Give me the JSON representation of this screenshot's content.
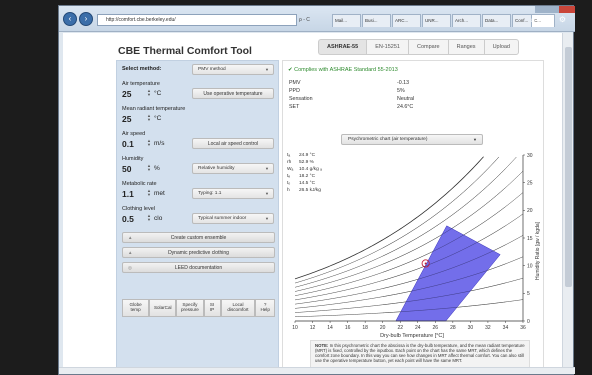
{
  "browser": {
    "url": "http://comfort.cbe.berkeley.edu/",
    "address_tools": "ρ - C",
    "tabs": [
      "Mail...",
      "Busi...",
      "ARC...",
      "UNR...",
      "Arch...",
      "Data...",
      "Conf...",
      "C..."
    ],
    "active_tab": "C...",
    "toolbar_icons": "⌂ ★ ⚙"
  },
  "app": {
    "title": "CBE Thermal Comfort Tool",
    "tabs": [
      "ASHRAE-55",
      "EN-15251",
      "Compare",
      "Ranges",
      "Upload"
    ],
    "active_tab": "ASHRAE-55"
  },
  "inputs": {
    "method_label": "Select method:",
    "method_value": "PMV method",
    "air_temp": {
      "label": "Air temperature",
      "value": "25",
      "unit": "°C",
      "button": "Use operative temperature"
    },
    "mrt": {
      "label": "Mean radiant temperature",
      "value": "25",
      "unit": "°C"
    },
    "air_speed": {
      "label": "Air speed",
      "value": "0.1",
      "unit": "m/s",
      "button": "Local air speed control"
    },
    "humidity": {
      "label": "Humidity",
      "value": "50",
      "unit": "%",
      "select": "Relative humidity"
    },
    "metabolic": {
      "label": "Metabolic rate",
      "value": "1.1",
      "unit": "met",
      "select": "Typing: 1.1"
    },
    "clothing": {
      "label": "Clothing level",
      "value": "0.5",
      "unit": "clo",
      "select": "Typical summer indoor"
    }
  },
  "actions": {
    "custom_ensemble": "Create custom ensemble",
    "dynamic_clothing": "Dynamic predictive clothing",
    "leed": "LEED documentation"
  },
  "tools": [
    {
      "line1": "Globe",
      "line2": "temp"
    },
    {
      "line1": "SolarCal",
      "line2": ""
    },
    {
      "line1": "Specify",
      "line2": "pressure"
    },
    {
      "line1": "SI",
      "line2": "IP"
    },
    {
      "line1": "Local",
      "line2": "discomfort"
    },
    {
      "line1": "?",
      "line2": "Help"
    }
  ],
  "results": {
    "compliance": "✔  Complies with ASHRAE Standard 55-2013",
    "rows": [
      {
        "k": "PMV",
        "v": "-0.13"
      },
      {
        "k": "PPD",
        "v": "5%"
      },
      {
        "k": "Sensation",
        "v": "Neutral"
      },
      {
        "k": "SET",
        "v": "24.6°C"
      }
    ]
  },
  "chart_select": "Psychrometric chart (air temperature)",
  "psych_readout": [
    {
      "k": "tₐ",
      "v": "24.9  °C"
    },
    {
      "k": "rh",
      "v": "52.9  %"
    },
    {
      "k": "Wₐ",
      "v": "10.4  g/kg ₐ"
    },
    {
      "k": "tₑ",
      "v": "18.2  °C"
    },
    {
      "k": "tₒ",
      "v": "14.5  °C"
    },
    {
      "k": "h",
      "v": "26.5  kJ/kg"
    }
  ],
  "chart_data": {
    "type": "scatter",
    "xlabel": "Dry-bulb Temperature [°C]",
    "ylabel": "Humidity Ratio [gw / kgda]",
    "xlim": [
      10,
      36
    ],
    "ylim": [
      0,
      30
    ],
    "x_ticks": [
      10,
      12,
      14,
      16,
      18,
      20,
      22,
      24,
      26,
      28,
      30,
      32,
      34,
      36
    ],
    "y_ticks": [
      0,
      5,
      10,
      15,
      20,
      25,
      30
    ],
    "comfort_zone_polygon": [
      [
        21.5,
        0
      ],
      [
        27.2,
        0
      ],
      [
        33.4,
        12.0
      ],
      [
        27.3,
        17.2
      ]
    ],
    "point": {
      "x": 24.9,
      "y": 10.4
    },
    "rh_curves": [
      10,
      20,
      30,
      40,
      50,
      60,
      70,
      80,
      90,
      100
    ],
    "colors": {
      "zone": "#5b55e6",
      "zone_stroke": "#3a34b8",
      "point": "#c0203a",
      "curves": "#333333"
    }
  },
  "note": {
    "bold": "NOTE:",
    "text": " In this psychrometric chart the abscissa is the dry-bulb temperature, and the mean radiant temperature (MRT) is fixed, controlled by the inputbox. Each point on the chart has the same MRT, which defines the comfort zone boundary. In this way you can see how changes in MRT affect thermal comfort. You can also still use the operative temperature button, yet each point will have the same MRT."
  }
}
